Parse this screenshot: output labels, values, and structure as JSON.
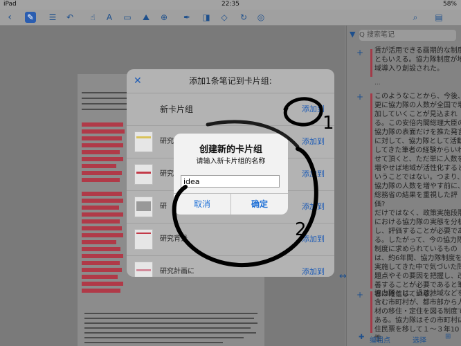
{
  "status_bar": {
    "device": "iPad",
    "time": "22:35",
    "battery": "58%"
  },
  "toolbar": {
    "back_icon": "chevron-left-icon",
    "tools": [
      "pen-tool",
      "list-tool",
      "undo",
      "redo",
      "hand-tool",
      "text-tool",
      "rectangle-tool",
      "image-tool",
      "share-tool",
      "highlighter-tool",
      "eraser-tool",
      "lasso-tool",
      "refresh-tool",
      "compass-tool"
    ],
    "right_icons": [
      "search-icon",
      "document-icon"
    ]
  },
  "sidebar": {
    "search_placeholder": "Q 搜索笔记",
    "notes": [
      "賃が活用できる画期的な制度\nともいえる。協力隊制度が地\n域導入り創設された。",
      "このようなことから、今後、\n更に協力隊の人数が全国で増\n加していくことが見込まれ\nる。この安倍内閣総理大臣の\n協力隊の表面だけを推た発言\nに対して、協力隊として活動\nしてきた筆者の経験からいわ\nせて頂くと、ただ単に人数を\n増やせば地域が活性化すると\nいうことではない。つまり、\n協力隊の人数を増やす前に、\n総務省の結果を重視した評価?\nだけではなく、政策実施段階\nにおける協力隊の実態を分析\nし、評価することが必要であ\nる。したがって、今の協力隊\n制度に求められているもの\nは、約6年間、協力隊制度を\n実施してきた中で気づいた問\n題点やその要因を把握し、改\n善することが必要であると筆\n者は確信している。",
      "協力隊とは、過疎地域などを\n含む市町村が、都市部から人\n材の移住・定住を図る制度で\nある。協力隊はその市町村に\n住民票を移して１～３年10性"
    ],
    "ellipsis": "...",
    "bottom": {
      "edit_label": "编辑点",
      "select_label": "选择"
    }
  },
  "modal": {
    "title": "添加1条笔记到卡片组:",
    "close_icon": "close-icon",
    "rows": [
      {
        "label": "新卡片组",
        "action": "添加到"
      },
      {
        "label": "研究プ",
        "action": "添加到"
      },
      {
        "label": "研究",
        "action": "添加到"
      },
      {
        "label": "研",
        "action": "添加到"
      },
      {
        "label": "研究背景",
        "action": "添加到"
      },
      {
        "label": "研究計画に",
        "action": "添加到"
      }
    ]
  },
  "alert": {
    "title": "创建新的卡片组",
    "message": "请输入新卡片组的名称",
    "input_value": "idea",
    "cancel_label": "取消",
    "confirm_label": "确定"
  },
  "annotations": {
    "label_1": "1",
    "label_2": "2"
  },
  "colors": {
    "accent": "#1d5bb5",
    "highlight": "#b03a48"
  }
}
